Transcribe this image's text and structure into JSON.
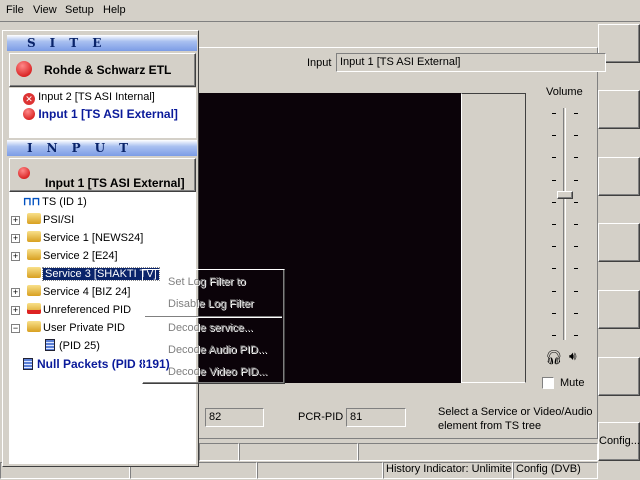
{
  "menu": [
    "File",
    "View",
    "Setup",
    "Help"
  ],
  "site": {
    "header": "SITE",
    "device": "Rohde & Schwarz ETL",
    "inputs": [
      {
        "label": "Input 2 [TS ASI Internal]",
        "state": "error"
      },
      {
        "label": "Input 1 [TS ASI External]",
        "state": "active"
      }
    ]
  },
  "input": {
    "header": "INPUT",
    "current": "Input 1 [TS ASI External]",
    "tree": [
      {
        "label": "TS (ID  1)",
        "icon": "ts-icon"
      },
      {
        "label": "PSI/SI",
        "icon": "folder-icon"
      },
      {
        "label": "Service  1 [NEWS24]",
        "icon": "folder-icon"
      },
      {
        "label": "Service  2 [E24]",
        "icon": "folder-icon"
      },
      {
        "label": "Service  3 [SHAKTI TV]",
        "icon": "folder-icon",
        "selected": true
      },
      {
        "label": "Service  4 [BIZ 24]",
        "icon": "folder-icon"
      },
      {
        "label": "Unreferenced PID",
        "icon": "folder-error-icon"
      },
      {
        "label": "User Private PID",
        "icon": "folder-icon"
      },
      {
        "label": "(PID 25)",
        "icon": "packet-icon"
      },
      {
        "label": "Null Packets (PID 8191)",
        "icon": "packet-icon"
      }
    ]
  },
  "context_menu": [
    "Set Log Filter to",
    "Disable Log Filter",
    "Decode service...",
    "Decode Audio PID...",
    "Decode Video PID..."
  ],
  "main": {
    "input_label": "Input",
    "input_value": "Input 1 [TS ASI External]",
    "volume_label": "Volume",
    "volume_level": 0.63,
    "mute_label": "Mute",
    "mute_checked": false,
    "pid_value": "82",
    "pcr_label": "PCR-PID",
    "pcr_value": "81",
    "hint": "Select a Service or Video/Audio element from TS tree",
    "config_button": "Config..."
  },
  "status": {
    "history": "History Indicator: Unlimited",
    "config": "Config (DVB)"
  }
}
